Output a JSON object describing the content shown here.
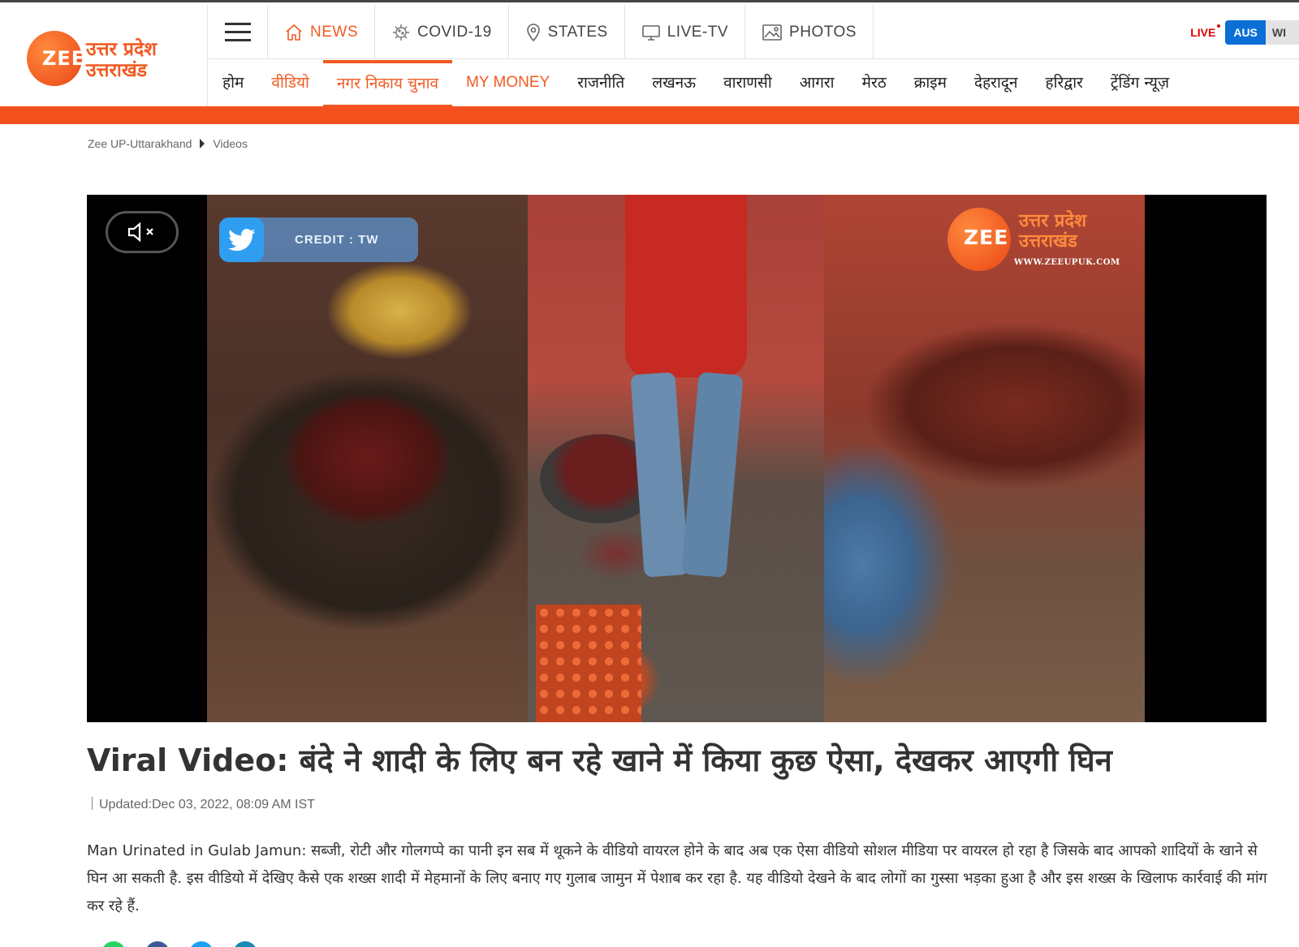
{
  "logo": {
    "zee": "ZEE",
    "line1": "उत्तर प्रदेश",
    "line2": "उत्तराखंड"
  },
  "topnav": {
    "items": [
      {
        "label": "NEWS",
        "icon": "home-icon"
      },
      {
        "label": "COVID-19",
        "icon": "virus-icon"
      },
      {
        "label": "STATES",
        "icon": "location-pin-icon"
      },
      {
        "label": "LIVE-TV",
        "icon": "monitor-icon"
      },
      {
        "label": "PHOTOS",
        "icon": "image-icon"
      }
    ],
    "live": "LIVE",
    "score": {
      "team1": "AUS",
      "team2": "WI"
    }
  },
  "subnav": {
    "items": [
      "होम",
      "वीडियो",
      "नगर निकाय चुनाव",
      "MY MONEY",
      "राजनीति",
      "लखनऊ",
      "वाराणसी",
      "आगरा",
      "मेरठ",
      "क्राइम",
      "देहरादून",
      "हरिद्वार",
      "ट्रेंडिंग न्यूज़"
    ]
  },
  "colors": {
    "accent": "#f15a22",
    "bar": "#f4511e",
    "live": "#dd0000",
    "score_blue": "#0b6fd6"
  },
  "breadcrumb": {
    "home": "Zee UP-Uttarakhand",
    "current": "Videos"
  },
  "video": {
    "credit": "CREDIT : TW",
    "watermark": {
      "zee": "ZEE",
      "line1": "उत्तर प्रदेश",
      "line2": "उत्तराखंड",
      "url": "WWW.ZEEUPUK.COM"
    },
    "mute_icon": "speaker-muted-icon"
  },
  "article": {
    "headline": "Viral Video: बंदे ने शादी के लिए बन रहे खाने में किया कुछ ऐसा, देखकर आएगी घिन",
    "updated": "Updated:Dec 03, 2022, 08:09 AM IST",
    "summary": "Man Urinated in Gulab Jamun: सब्जी, रोटी और गोलगप्पे का पानी इन सब में थूकने के वीडियो वायरल होने के बाद अब एक ऐसा वीडियो सोशल मीडिया पर वायरल हो रहा है जिसके बाद आपको शादियों के खाने से घिन आ सकती है. इस वीडियो में देखिए कैसे एक शख्स शादी में मेहमानों के लिए बनाए गए गुलाब जामुन में पेशाब कर रहा है. यह वीडियो देखने के बाद लोगों का गुस्सा भड़का हुआ है और इस शख्स के खिलाफ कार्रवाई की मांग कर रहे हैं."
  }
}
